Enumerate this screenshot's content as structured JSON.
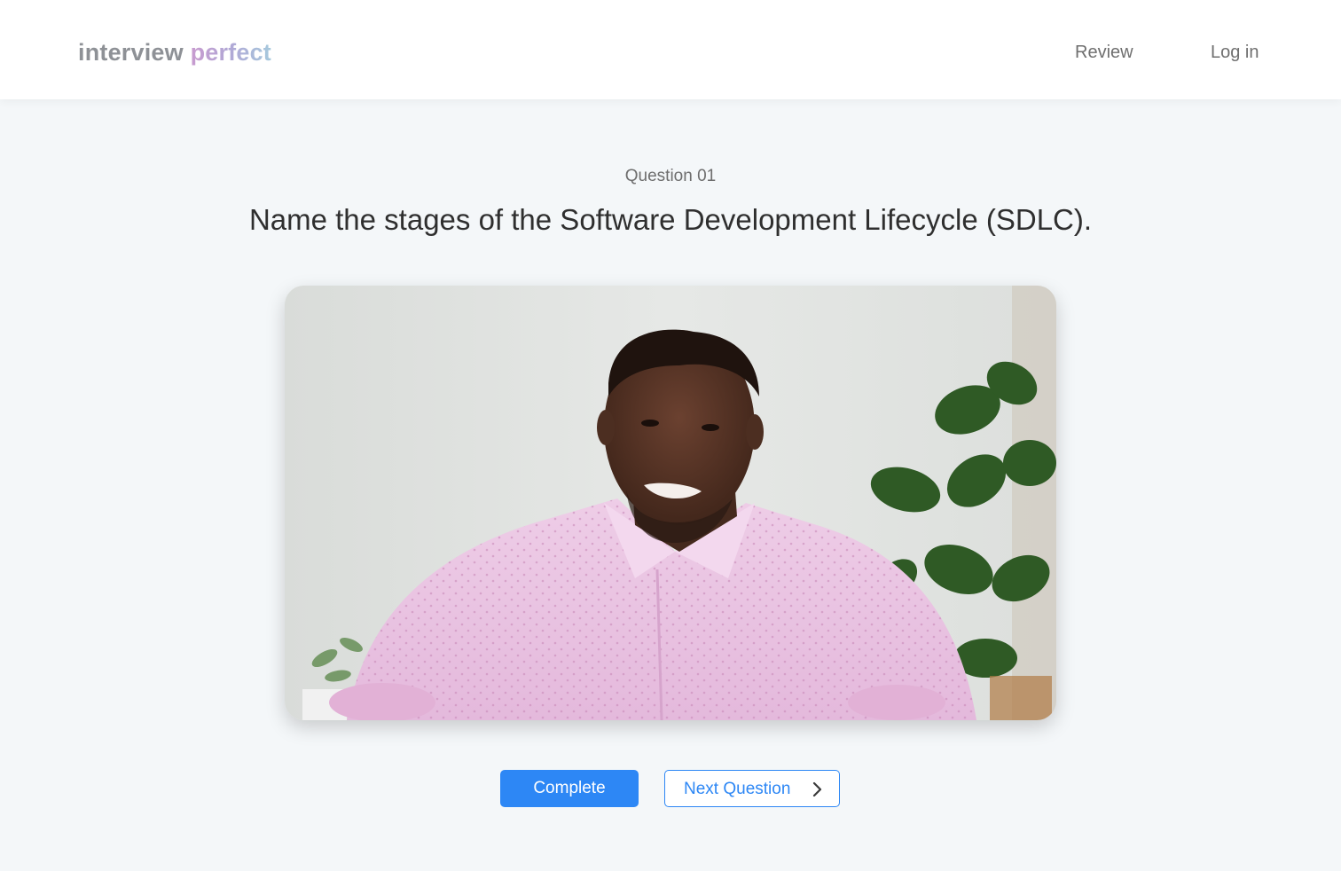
{
  "header": {
    "logo": {
      "part1": "interview",
      "part2": "perfect"
    },
    "nav": {
      "review": "Review",
      "login": "Log in"
    }
  },
  "question": {
    "label": "Question 01",
    "text": "Name the stages of the Software Development Lifecycle (SDLC)."
  },
  "video": {
    "subject": "person-in-pink-shirt-webcam-feed"
  },
  "actions": {
    "complete": "Complete",
    "next": "Next Question",
    "next_icon": "chevron-right-icon"
  },
  "colors": {
    "accent": "#2d87f5",
    "background": "#f4f7f9",
    "header_bg": "#ffffff"
  }
}
